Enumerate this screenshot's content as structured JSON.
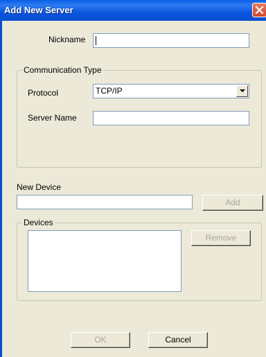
{
  "window": {
    "title": "Add New Server"
  },
  "nickname": {
    "label": "Nickname",
    "value": ""
  },
  "communication": {
    "group_label": "Communication Type",
    "protocol_label": "Protocol",
    "protocol_value": "TCP/IP",
    "server_name_label": "Server Name",
    "server_name_value": ""
  },
  "new_device": {
    "label": "New Device",
    "value": "",
    "add_label": "Add"
  },
  "devices": {
    "group_label": "Devices",
    "items": [],
    "remove_label": "Remove"
  },
  "footer": {
    "ok_label": "OK",
    "cancel_label": "Cancel"
  },
  "colors": {
    "title_bar": "#0a5fe6",
    "dialog_bg": "#ece9d8",
    "close_button": "#d3432a"
  },
  "icons": {
    "close": "close-icon",
    "dropdown": "chevron-down-icon"
  }
}
